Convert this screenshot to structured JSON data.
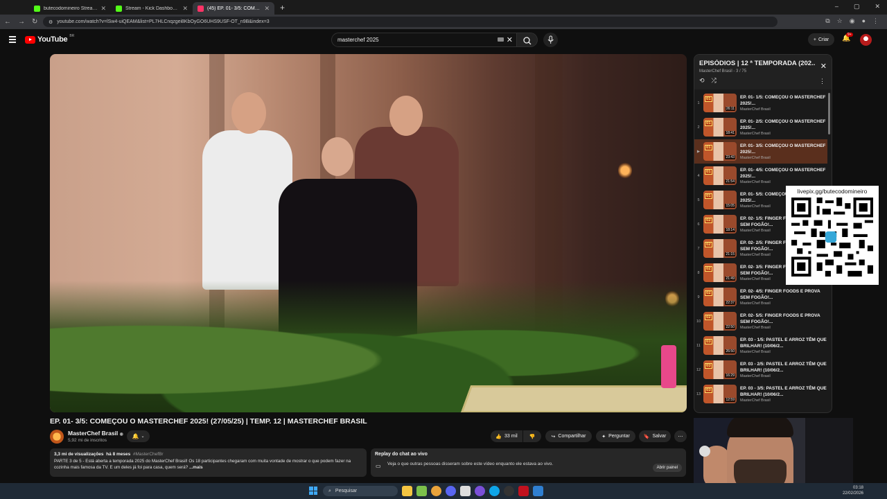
{
  "browser": {
    "tabs": [
      {
        "label": "butecodomineiro Stream - Wat...",
        "color": "#53fc18",
        "active": false
      },
      {
        "label": "Stream - Kick Dashboard",
        "color": "#53fc18",
        "active": false
      },
      {
        "label": "(45) EP. 01- 3/5: COMEÇO...",
        "color": "#ff3366",
        "active": true
      }
    ],
    "url": "youtube.com/watch?v=lSw4-uiQEAM&list=PL7HLCnqzgei8KbOyGO6UHS9USF-OT_n9B&index=3"
  },
  "youtube": {
    "logo_text": "YouTube",
    "logo_region": "BR",
    "search_value": "masterchef 2025",
    "create_label": "Criar",
    "notif_badge": "9+"
  },
  "video": {
    "title": "EP. 01- 3/5: COMEÇOU O MASTERCHEF 2025! (27/05/25) | TEMP. 12 | MASTERCHEF BRASIL",
    "channel": "MasterChef Brasil",
    "subscribers": "5,92 mi de inscritos",
    "likes": "33 mil",
    "share_label": "Compartilhar",
    "ask_label": "Perguntar",
    "save_label": "Salvar"
  },
  "description": {
    "views": "3,3 mi de visualizações",
    "age": "há 8 meses",
    "hashtag": "#MasterChefBr",
    "text": "PARTE 3 de 5 - Está aberta a temporada 2025 do MasterChef Brasil! Os 18 participantes chegaram com muita vontade de mostrar o que podem fazer na cozinha mais famosa da TV. E um deles já foi para casa, quem será?",
    "more": "...mais"
  },
  "chat_replay": {
    "title": "Replay do chat ao vivo",
    "body": "Veja o que outras pessoas disseram sobre este vídeo enquanto ele estava ao vivo.",
    "open_label": "Abrir painel"
  },
  "playlist": {
    "title": "EPISÓDIOS | 12 ª TEMPORADA (202...",
    "subtitle": "MasterChef Brasil - 3 / 75",
    "items": [
      {
        "index": "1",
        "ep": "01",
        "title": "EP. 01- 1/5: COMEÇOU O MASTERCHEF 2025!...",
        "channel": "MasterChef Brasil",
        "duration": "26:11",
        "active": false
      },
      {
        "index": "2",
        "ep": "01",
        "title": "EP. 01- 2/5: COMEÇOU O MASTERCHEF 2025!...",
        "channel": "MasterChef Brasil",
        "duration": "18:41",
        "active": false
      },
      {
        "index": "▶",
        "ep": "01",
        "title": "EP. 01- 3/5: COMEÇOU O MASTERCHEF 2025!...",
        "channel": "MasterChef Brasil",
        "duration": "23:43",
        "active": true
      },
      {
        "index": "4",
        "ep": "01",
        "title": "EP. 01- 4/5: COMEÇOU O MASTERCHEF 2025!...",
        "channel": "MasterChef Brasil",
        "duration": "21:54",
        "active": false
      },
      {
        "index": "5",
        "ep": "01",
        "title": "EP. 01- 5/5: COMEÇOU O MASTERCHEF 2025!...",
        "channel": "MasterChef Brasil",
        "duration": "15:05",
        "active": false
      },
      {
        "index": "6",
        "ep": "02",
        "title": "EP. 02- 1/5: FINGER FOODS E PROVA SEM FOGÃO!...",
        "channel": "MasterChef Brasil",
        "duration": "18:14",
        "active": false
      },
      {
        "index": "7",
        "ep": "02",
        "title": "EP. 02- 2/5: FINGER FOODS E PROVA SEM FOGÃO!...",
        "channel": "MasterChef Brasil",
        "duration": "21:15",
        "active": false
      },
      {
        "index": "8",
        "ep": "02",
        "title": "EP. 02- 3/5: FINGER FOODS E PROVA SEM FOGÃO!...",
        "channel": "MasterChef Brasil",
        "duration": "21:49",
        "active": false
      },
      {
        "index": "9",
        "ep": "02",
        "title": "EP. 02- 4/5: FINGER FOODS E PROVA SEM FOGÃO!...",
        "channel": "MasterChef Brasil",
        "duration": "22:37",
        "active": false
      },
      {
        "index": "10",
        "ep": "02",
        "title": "EP. 02- 5/5: FINGER FOODS E PROVA SEM FOGÃO!...",
        "channel": "MasterChef Brasil",
        "duration": "22:50",
        "active": false
      },
      {
        "index": "11",
        "ep": "03",
        "title": "EP. 03 - 1/5: PASTEL E ARROZ TÊM QUE BRILHAR! (10/06/2...",
        "channel": "MasterChef Brasil",
        "duration": "26:50",
        "active": false
      },
      {
        "index": "12",
        "ep": "03",
        "title": "EP. 03 - 2/5: PASTEL E ARROZ TÊM QUE BRILHAR! (10/06/2...",
        "channel": "MasterChef Brasil",
        "duration": "16:29",
        "active": false
      },
      {
        "index": "13",
        "ep": "03",
        "title": "EP. 03 - 3/5: PASTEL E ARROZ TÊM QUE BRILHAR! (10/06/2...",
        "channel": "MasterChef Brasil",
        "duration": "12:59",
        "active": false
      }
    ]
  },
  "overlay": {
    "qr_label": "livepix.gg/butecodomineiro"
  },
  "taskbar": {
    "search_label": "Pesquisar",
    "time": "03:18",
    "date": "22/02/2026"
  }
}
